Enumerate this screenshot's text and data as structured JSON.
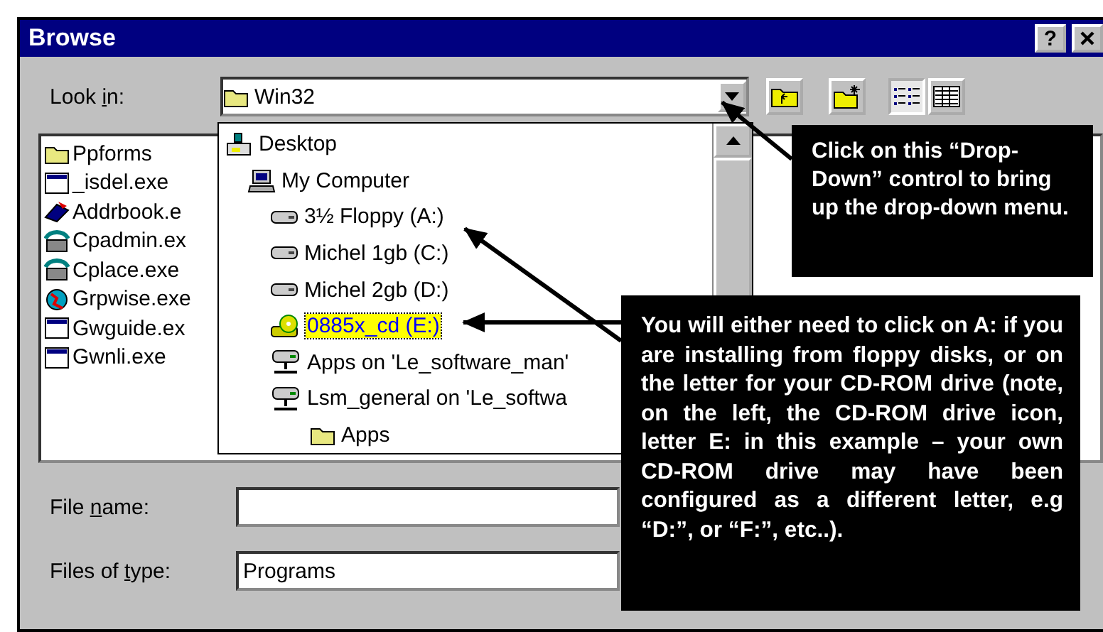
{
  "window": {
    "title": "Browse",
    "help": "?"
  },
  "look_in": {
    "label_before": "Look ",
    "mnemonic": "i",
    "label_after": "n:",
    "value": "Win32"
  },
  "toolbar": [
    {
      "kind": "up-folder",
      "selected": false
    },
    {
      "kind": "new-folder",
      "selected": false
    },
    {
      "kind": "list-view",
      "selected": true
    },
    {
      "kind": "details-view",
      "selected": false
    }
  ],
  "files": [
    {
      "name": "Ppforms",
      "kind": "folder"
    },
    {
      "name": "_isdel.exe",
      "kind": "window"
    },
    {
      "name": "Addrbook.e",
      "kind": "book"
    },
    {
      "name": "Cpadmin.ex",
      "kind": "phone"
    },
    {
      "name": "Cplace.exe",
      "kind": "phone"
    },
    {
      "name": "Grpwise.exe",
      "kind": "globe"
    },
    {
      "name": "Gwguide.ex",
      "kind": "window"
    },
    {
      "name": "Gwnli.exe",
      "kind": "window"
    }
  ],
  "dropdown": [
    {
      "name": "Desktop",
      "kind": "desktop",
      "selected": false,
      "children": [
        {
          "name": "My Computer",
          "kind": "computer",
          "selected": false,
          "children": [
            {
              "name": "3½ Floppy (A:)",
              "kind": "drive",
              "selected": false
            },
            {
              "name": "Michel 1gb (C:)",
              "kind": "drive",
              "selected": false
            },
            {
              "name": "Michel 2gb (D:)",
              "kind": "drive",
              "selected": false
            },
            {
              "name": "0885x_cd (E:)",
              "kind": "cdrom",
              "selected": true
            },
            {
              "name": "Apps on 'Le_software_man'",
              "kind": "netdrive",
              "selected": false
            },
            {
              "name": "Lsm_general on 'Le_softwa",
              "kind": "netdrive",
              "selected": false,
              "children": [
                {
                  "name": "Apps",
                  "kind": "folder",
                  "selected": false
                }
              ]
            }
          ]
        }
      ]
    }
  ],
  "file_name": {
    "label_before": "File ",
    "mnemonic": "n",
    "label_after": "ame:"
  },
  "files_of_type": {
    "label_before": "Files of ",
    "mnemonic": "t",
    "label_after": "ype:",
    "value": "Programs"
  },
  "callouts": [
    {
      "kind": "top",
      "text": "Click on this  “Drop-Down” control to bring up the drop-down menu."
    },
    {
      "kind": "bottom",
      "text": "You will either need to click on A: if you are installing from floppy disks, or on the letter for your CD-ROM drive  (note, on the left, the CD-ROM drive icon, letter E:  in this example – your own CD-ROM drive may have been configured as a different letter, e.g “D:”, or “F:”, etc..)."
    }
  ]
}
